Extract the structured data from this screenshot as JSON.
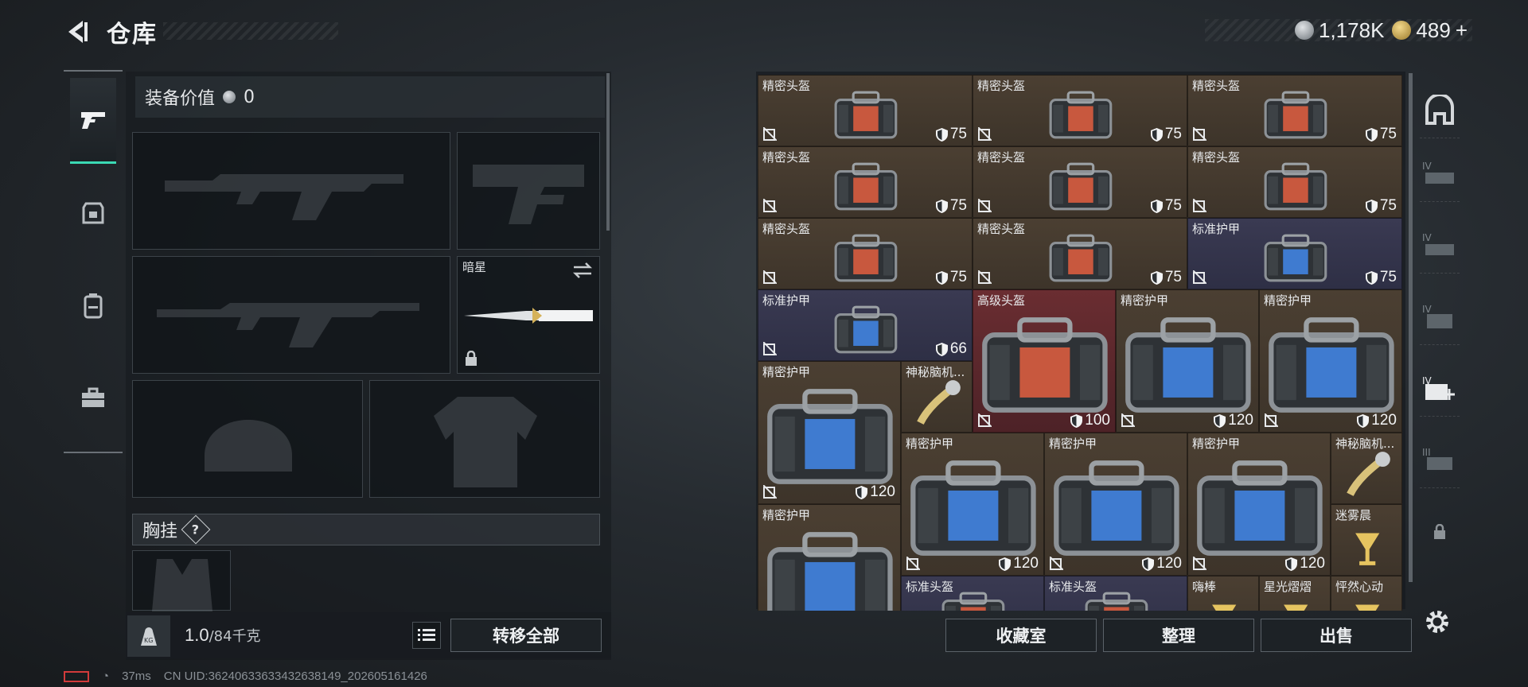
{
  "header": {
    "title": "仓库"
  },
  "currency": {
    "silver": "1,178K",
    "gold": "489",
    "gold_add": "+"
  },
  "equipment": {
    "value_label": "装备价值",
    "value": "0",
    "melee_name": "暗星",
    "chest_label": "胸挂",
    "help_mark": "?",
    "weight": "1.0",
    "weight_cap": "/84千克",
    "transfer_all": "转移全部"
  },
  "storage": {
    "items": [
      {
        "name": "精密头盔",
        "durability": "75",
        "bg": "brown",
        "kind": "helmet"
      },
      {
        "name": "精密头盔",
        "durability": "75",
        "bg": "brown",
        "kind": "helmet"
      },
      {
        "name": "精密头盔",
        "durability": "75",
        "bg": "brown",
        "kind": "helmet"
      },
      {
        "name": "精密头盔",
        "durability": "75",
        "bg": "brown",
        "kind": "helmet"
      },
      {
        "name": "精密头盔",
        "durability": "75",
        "bg": "brown",
        "kind": "helmet"
      },
      {
        "name": "精密头盔",
        "durability": "75",
        "bg": "brown",
        "kind": "helmet"
      },
      {
        "name": "精密头盔",
        "durability": "75",
        "bg": "brown",
        "kind": "helmet"
      },
      {
        "name": "精密头盔",
        "durability": "75",
        "bg": "brown",
        "kind": "helmet"
      },
      {
        "name": "标准护甲",
        "durability": "75",
        "bg": "blue",
        "kind": "armor"
      },
      {
        "name": "标准护甲",
        "durability": "66",
        "bg": "blue",
        "kind": "armor"
      },
      {
        "name": "高级头盔",
        "durability": "100",
        "bg": "red",
        "kind": "helmet"
      },
      {
        "name": "精密护甲",
        "durability": "120",
        "bg": "brown",
        "kind": "armor"
      },
      {
        "name": "精密护甲",
        "durability": "120",
        "bg": "brown",
        "kind": "armor"
      },
      {
        "name": "精密护甲",
        "durability": "120",
        "bg": "brown",
        "kind": "armor"
      },
      {
        "name": "神秘脑机...",
        "durability": "",
        "bg": "brown",
        "kind": "device"
      },
      {
        "name": "精密护甲",
        "durability": "120",
        "bg": "brown",
        "kind": "armor"
      },
      {
        "name": "精密护甲",
        "durability": "120",
        "bg": "brown",
        "kind": "armor"
      },
      {
        "name": "精密护甲",
        "durability": "120",
        "bg": "brown",
        "kind": "armor"
      },
      {
        "name": "神秘脑机...",
        "durability": "",
        "bg": "brown",
        "kind": "device"
      },
      {
        "name": "精密护甲",
        "durability": "",
        "bg": "brown",
        "kind": "armor"
      },
      {
        "name": "迷雾晨",
        "durability": "",
        "bg": "brown",
        "kind": "drink"
      },
      {
        "name": "标准头盔",
        "durability": "",
        "bg": "blue",
        "kind": "helmet"
      },
      {
        "name": "标准头盔",
        "durability": "",
        "bg": "blue",
        "kind": "helmet"
      },
      {
        "name": "嗨棒",
        "durability": "",
        "bg": "brown",
        "kind": "drink"
      },
      {
        "name": "星光熠熠",
        "durability": "",
        "bg": "brown",
        "kind": "drink"
      },
      {
        "name": "怦然心动",
        "durability": "",
        "bg": "brown",
        "kind": "drink"
      }
    ],
    "collection_button": "收藏室",
    "sort_button": "整理",
    "sell_button": "出售"
  },
  "filters": {
    "tier_iv": "IV",
    "tier_iii": "III"
  },
  "footer": {
    "ping": "37ms",
    "uid": "CN UID:3624063363343263814​9_202605161426"
  },
  "colors": {
    "accent": "#3bd9b4",
    "brown_cell": "#4b3f32",
    "blue_cell": "#3a3a52",
    "red_cell": "#6a2d31"
  }
}
